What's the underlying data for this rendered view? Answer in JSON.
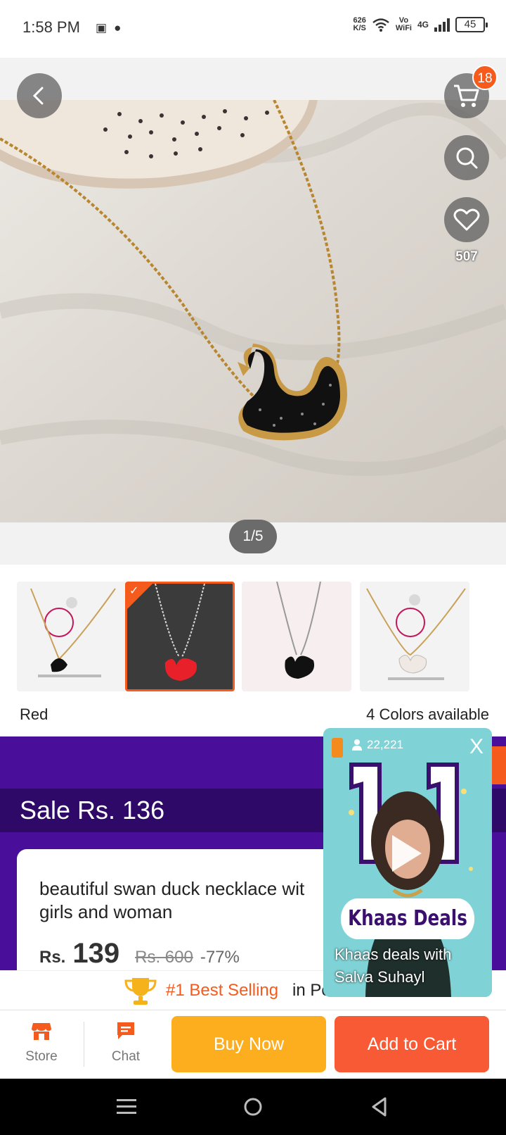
{
  "status_bar": {
    "time": "1:58 PM",
    "speed_value": "626",
    "speed_unit": "K/S",
    "vo": "Vo",
    "wifi": "WiFi",
    "network": "4G",
    "battery": "45"
  },
  "gallery": {
    "cart_count": "18",
    "favorites_count": "507",
    "page_indicator": "1/5"
  },
  "colors": {
    "selected": "Red",
    "available": "4 Colors available",
    "options": [
      "Black (AB)",
      "Red",
      "Black",
      "White (AB)"
    ]
  },
  "sale": {
    "label": "Sale Rs. 136"
  },
  "product": {
    "title": "beautiful swan duck necklace with ... girls and woman",
    "title_line1": "beautiful swan duck necklace wit",
    "title_line2": "girls and woman",
    "currency": "Rs.",
    "price": "139",
    "old_price": "Rs. 600",
    "discount": "-77%"
  },
  "best_selling": {
    "label": "#1 Best Selling",
    "suffix": "in Pe"
  },
  "actions": {
    "store": "Store",
    "chat": "Chat",
    "buy_now": "Buy Now",
    "add_to_cart": "Add to Cart"
  },
  "video": {
    "viewers": "22,221",
    "close": "X",
    "brand": "Khaas Deals",
    "caption": "Khaas deals with Salva Suhayl"
  },
  "colors_palette": {
    "accent": "#f45b1d",
    "sale_purple": "#4a0f9a",
    "buy_now": "#fcae1e",
    "add_to_cart": "#f85a36"
  }
}
